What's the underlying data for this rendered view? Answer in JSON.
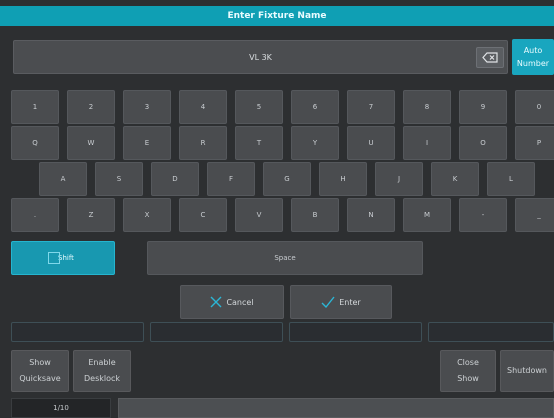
{
  "dialog": {
    "title": "Enter Fixture Name",
    "name_value": "VL 3K",
    "auto_number": [
      "Auto",
      "Number"
    ]
  },
  "keyboard": {
    "rows": [
      [
        "1",
        "2",
        "3",
        "4",
        "5",
        "6",
        "7",
        "8",
        "9",
        "0"
      ],
      [
        "Q",
        "W",
        "E",
        "R",
        "T",
        "Y",
        "U",
        "I",
        "O",
        "P"
      ],
      [
        "A",
        "S",
        "D",
        "F",
        "G",
        "H",
        "J",
        "K",
        "L"
      ],
      [
        ".",
        "Z",
        "X",
        "C",
        "V",
        "B",
        "N",
        "M",
        "-",
        "_"
      ]
    ],
    "shift_label": "Shift",
    "space_label": "Space",
    "cancel_label": "Cancel",
    "enter_label": "Enter"
  },
  "footer": {
    "show_quicksave": [
      "Show",
      "Quicksave"
    ],
    "enable_desklock": [
      "Enable",
      "Desklock"
    ],
    "close_show": [
      "Close",
      "Show"
    ],
    "shutdown": "Shutdown",
    "page": "1/10"
  },
  "colors": {
    "accent": "#19a6bf",
    "background": "#2d2f31",
    "key": "#4a4c4f",
    "cancel_icon": "#2bb6d6",
    "enter_icon": "#2bb6d6"
  },
  "icons": {
    "backspace": "backspace-icon",
    "cancel": "x-icon",
    "enter": "check-icon",
    "shift": "shift-icon"
  }
}
